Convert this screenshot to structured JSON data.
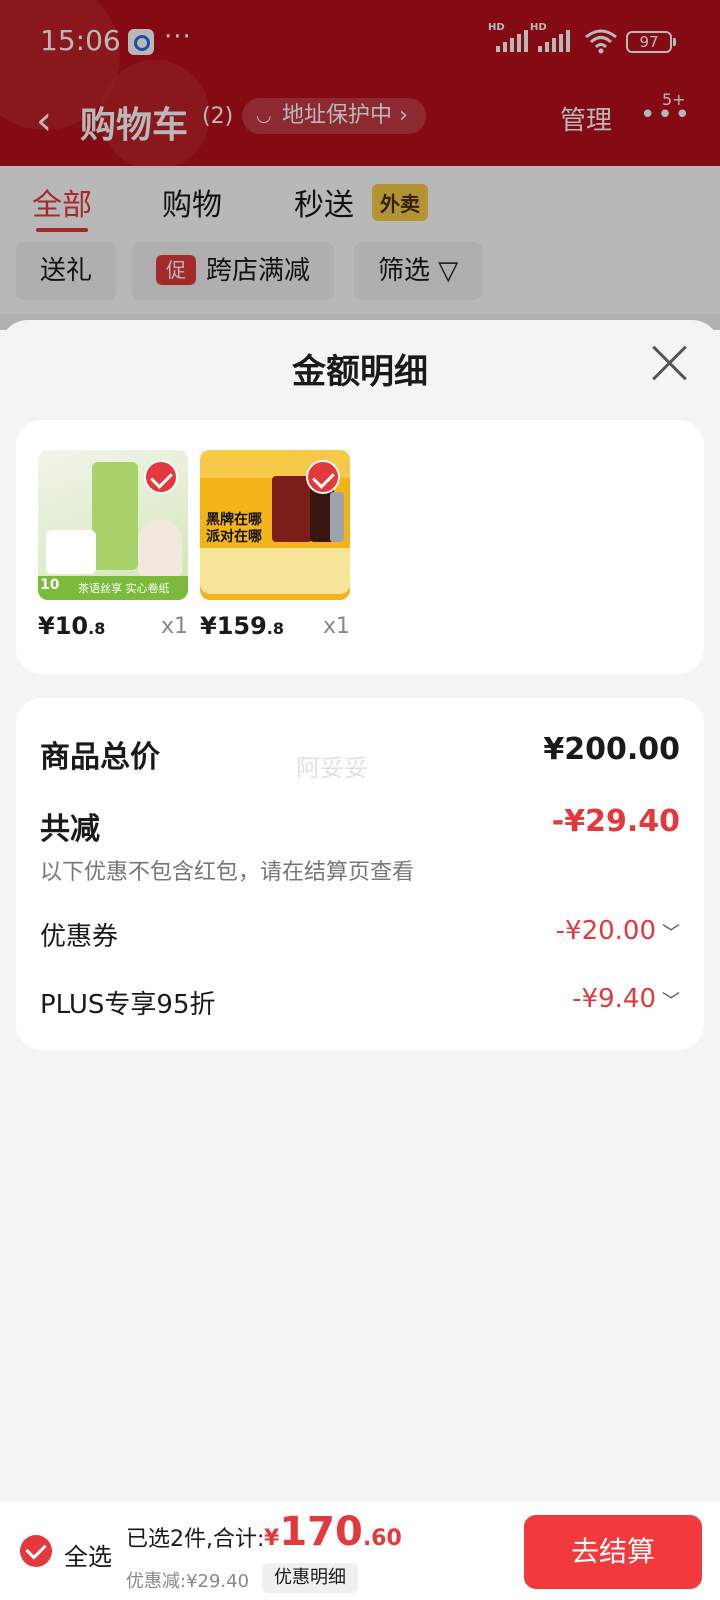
{
  "status_bar": {
    "time": "15:06",
    "more": "···",
    "hd1": "HD",
    "hd2": "HD",
    "battery": "97"
  },
  "nav": {
    "back": "‹",
    "title": "购物车",
    "count": "(2)",
    "address_badge": "地址保护中 ›",
    "manage": "管理",
    "more_badge": "5+"
  },
  "tabs": [
    {
      "label": "全部"
    },
    {
      "label": "购物"
    },
    {
      "label": "秒送",
      "tag": "外卖"
    }
  ],
  "filters": {
    "gift": "送礼",
    "promo_tag": "促",
    "cross_store": "跨店满减",
    "filter": "筛选 ▽"
  },
  "sheet": {
    "title": "金额明细",
    "products": [
      {
        "price_int": "¥10",
        "price_dec": ".8",
        "qty": "x1",
        "thumb_caption": "茶语丝享 实心卷纸",
        "thumb_badge": "10"
      },
      {
        "price_int": "¥159",
        "price_dec": ".8",
        "qty": "x1",
        "thumb_caption": "黑牌在哪 派对在哪"
      }
    ],
    "summary": {
      "total_label": "商品总价",
      "total_value": "¥200.00",
      "reduce_label": "共减",
      "reduce_value": "-¥29.40",
      "reduce_note": "以下优惠不包含红包，请在结算页查看",
      "coupon_label": "优惠券",
      "coupon_value": "-¥20.00",
      "plus_label": "PLUS专享95折",
      "plus_value": "-¥9.40"
    },
    "watermark": "阿妥妥"
  },
  "bottom_bar": {
    "select_all": "全选",
    "selected_text": "已选2件,合计:",
    "total_currency": "¥",
    "total_int": "170",
    "total_dec": ".60",
    "discount_text": "优惠减:¥29.40",
    "detail_button": "优惠明细",
    "checkout": "去结算"
  },
  "colors": {
    "accent": "#e4393c",
    "header": "#b70f1c",
    "checkout": "#f23a3c"
  }
}
